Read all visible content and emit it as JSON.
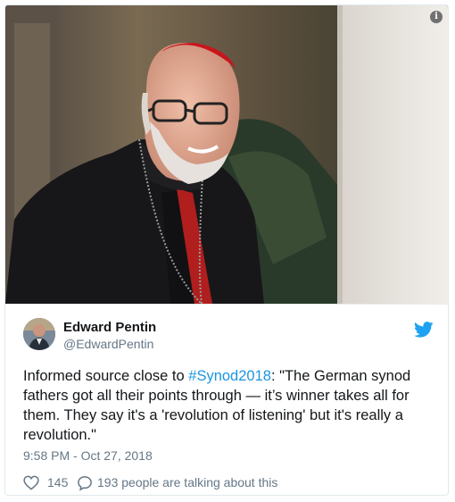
{
  "tweet": {
    "author_name": "Edward Pentin",
    "author_handle": "@EdwardPentin",
    "text_before": "Informed source close to ",
    "hashtag": "#Synod2018",
    "text_after": ": \"The German synod fathers got all their points through — it’s winner takes all for them. They say it's a 'revolution of listening' but it's really a revolution.\"",
    "timestamp": "9:58 PM - Oct 27, 2018",
    "likes": "145",
    "conversation": "193 people are talking about this"
  },
  "icons": {
    "info": "info-icon",
    "platform": "bird-icon",
    "like": "heart-icon",
    "reply": "speech-bubble-icon"
  },
  "colors": {
    "link": "#1b95e0",
    "brand": "#1da1f2",
    "text": "#14171a",
    "muted": "#657786"
  }
}
